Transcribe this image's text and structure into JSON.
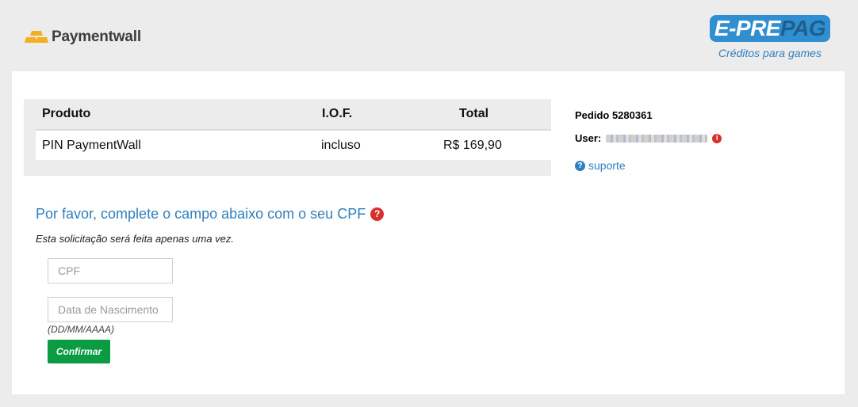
{
  "header": {
    "paymentwall_logo": "Paymentwall",
    "eprepag_logo": {
      "part1": "E-PRE",
      "part2": "PAG"
    },
    "eprepag_tagline": "Créditos para games"
  },
  "product_table": {
    "headers": {
      "produto": "Produto",
      "iof": "I.O.F.",
      "total": "Total"
    },
    "rows": [
      {
        "produto": "PIN PaymentWall",
        "iof": "incluso",
        "total": "R$ 169,90"
      }
    ]
  },
  "order": {
    "pedido_label": "Pedido 5280361",
    "user_label": "User:",
    "suporte_label": "suporte"
  },
  "cpf_form": {
    "title": "Por favor, complete o campo abaixo com o seu CPF",
    "note": "Esta solicitação será feita apenas uma vez.",
    "cpf_placeholder": "CPF",
    "birthdate_placeholder": "Data de Nascimento",
    "birthdate_hint": "(DD/MM/AAAA)",
    "confirm_label": "Confirmar"
  },
  "colors": {
    "accent_blue": "#2f7fbf",
    "confirm_green": "#0a9b43",
    "alert_red": "#d9302c",
    "logo_gold": "#f2b01e"
  },
  "icons": {
    "paymentwall": "gold-bars-icon",
    "user_info": "info-icon",
    "suporte": "question-circle-icon",
    "cpf_help": "question-circle-icon"
  }
}
